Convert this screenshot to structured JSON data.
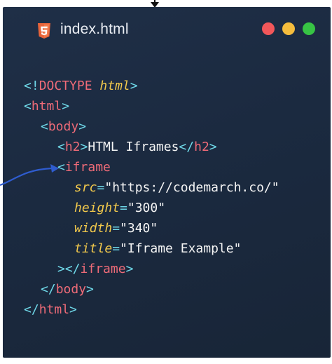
{
  "window": {
    "file_name": "index.html",
    "file_icon": "html5-icon",
    "controls": [
      "close-dot",
      "minimize-dot",
      "maximize-dot"
    ]
  },
  "colors": {
    "background": "#1c2b41",
    "tag": "#ef6b78",
    "punctuation": "#6fd8e8",
    "attribute": "#f2c94c",
    "string": "#f4f4f4",
    "dot_red": "#f2575a",
    "dot_yellow": "#f5bd3d",
    "dot_green": "#37c444",
    "arrow": "#2f5ccf"
  },
  "code": {
    "doctype": {
      "open": "<!",
      "keyword": "DOCTYPE",
      "value": "html",
      "close": ">"
    },
    "html_open": {
      "open": "<",
      "tag": "html",
      "close": ">"
    },
    "body_open": {
      "open": "<",
      "tag": "body",
      "close": ">"
    },
    "h2_line": {
      "open": "<",
      "tag": "h2",
      "close": ">",
      "text": "HTML Iframes",
      "end_open": "</",
      "end_tag": "h2",
      "end_close": ">"
    },
    "iframe_open": {
      "open": "<",
      "tag": "iframe"
    },
    "attrs": [
      {
        "name": "src",
        "eq": "=",
        "value": "\"https://codemarch.co/\""
      },
      {
        "name": "height",
        "eq": "=",
        "value": "\"300\""
      },
      {
        "name": "width",
        "eq": "=",
        "value": "\"340\""
      },
      {
        "name": "title",
        "eq": "=",
        "value": "\"Iframe Example\""
      }
    ],
    "iframe_close": {
      "gt": ">",
      "end_open": "</",
      "tag": "iframe",
      "close": ">"
    },
    "body_close": {
      "open": "</",
      "tag": "body",
      "close": ">"
    },
    "html_close": {
      "open": "</",
      "tag": "html",
      "close": ">"
    }
  }
}
